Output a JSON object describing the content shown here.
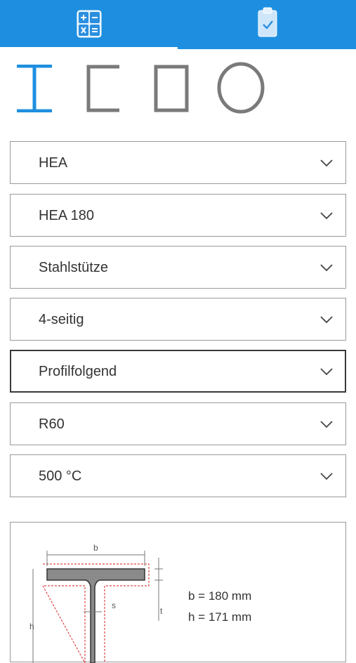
{
  "header": {
    "tabs": [
      {
        "name": "calculator",
        "icon": "calculator-icon",
        "active": true
      },
      {
        "name": "report",
        "icon": "clipboard-check-icon",
        "active": false
      }
    ],
    "color": "#1e8fe0"
  },
  "profile_types": {
    "items": [
      {
        "icon": "i-beam-profile-icon",
        "active": true
      },
      {
        "icon": "u-channel-profile-icon",
        "active": false
      },
      {
        "icon": "rectangular-hollow-profile-icon",
        "active": false
      },
      {
        "icon": "circular-hollow-profile-icon",
        "active": false
      }
    ],
    "active_color": "#1e8fe0",
    "inactive_color": "#7a7a7a"
  },
  "selects": {
    "profile_series": "HEA",
    "profile_size": "HEA 180",
    "member_type": "Stahlstütze",
    "exposure": "4-seitig",
    "cladding": "Profilfolgend",
    "fire_rating": "R60",
    "critical_temp": "500 °C"
  },
  "diagram": {
    "label_b": "b",
    "label_h": "h",
    "label_s": "s",
    "label_t": "t",
    "dimensions": {
      "b": "b = 180 mm",
      "h": "h = 171 mm"
    }
  }
}
